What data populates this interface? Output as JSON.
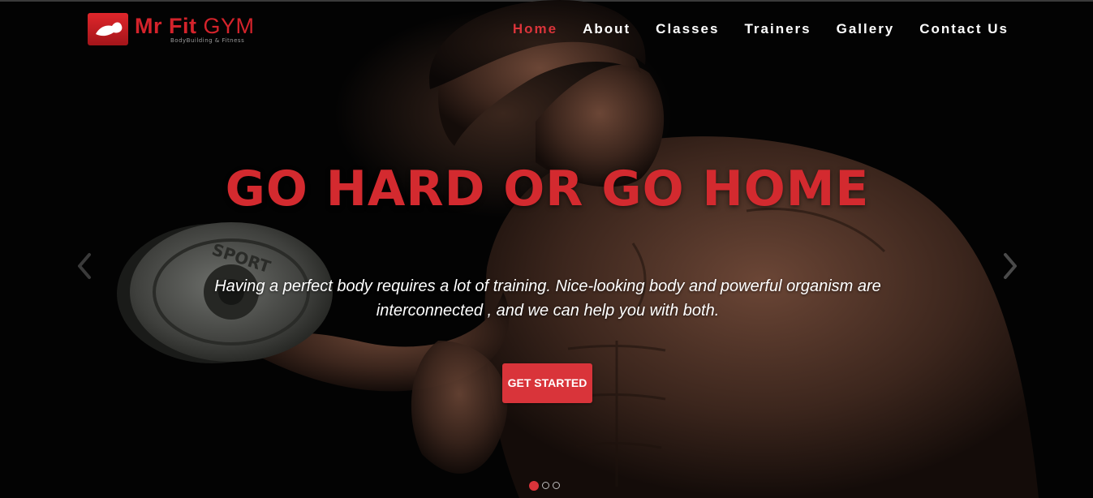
{
  "logo": {
    "icon": "flexed-arm-icon",
    "name_part1": "Mr Fit",
    "name_part2": "GYM",
    "tagline": "BodyBuilding & Fitness"
  },
  "nav": {
    "items": [
      {
        "label": "Home",
        "active": true
      },
      {
        "label": "About",
        "active": false
      },
      {
        "label": "Classes",
        "active": false
      },
      {
        "label": "Trainers",
        "active": false
      },
      {
        "label": "Gallery",
        "active": false
      },
      {
        "label": "Contact Us",
        "active": false
      }
    ]
  },
  "hero": {
    "headline": "GO HARD OR GO HOME",
    "subtext": "Having a perfect body requires a lot of training. Nice-looking body and powerful organism are interconnected , and we can help you with both.",
    "cta_label": "GET STARTED",
    "dumbbell_plate_text": "SPORT"
  },
  "carousel": {
    "prev_icon": "chevron-left-icon",
    "next_icon": "chevron-right-icon",
    "slide_count": 3,
    "active_slide": 1
  },
  "colors": {
    "accent": "#d9343a",
    "headline": "#d32a2f",
    "background": "#030303",
    "nav_text": "#ffffff"
  }
}
